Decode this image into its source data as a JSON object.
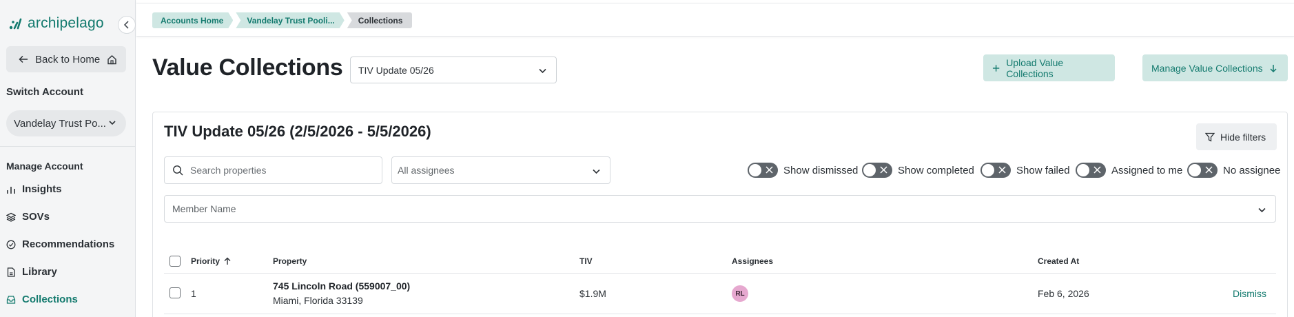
{
  "app": {
    "logo_text": "archipelago",
    "accent_color": "#137a6e"
  },
  "sidebar": {
    "back_label": "Back to Home",
    "switch_account_label": "Switch Account",
    "account_value": "Vandelay Trust Po...",
    "manage_account_label": "Manage Account",
    "items": [
      {
        "label": "Insights",
        "icon": "bar-chart-icon",
        "active": false
      },
      {
        "label": "SOVs",
        "icon": "layers-icon",
        "active": false
      },
      {
        "label": "Recommendations",
        "icon": "check-circle-icon",
        "active": false
      },
      {
        "label": "Library",
        "icon": "document-icon",
        "active": false
      },
      {
        "label": "Collections",
        "icon": "inbox-icon",
        "active": true
      }
    ]
  },
  "breadcrumbs": [
    "Accounts Home",
    "Vandelay Trust Pooli...",
    "Collections"
  ],
  "header": {
    "title": "Value Collections",
    "collection_value": "TIV Update 05/26",
    "upload_label": "Upload Value Collections",
    "manage_label": "Manage Value Collections"
  },
  "card": {
    "title": "TIV Update 05/26 (2/5/2026 - 5/5/2026)",
    "hide_filters_label": "Hide filters",
    "search_placeholder": "Search properties",
    "assignee_value": "All assignees",
    "member_value": "Member Name",
    "toggles": [
      "Show dismissed",
      "Show completed",
      "Show failed",
      "Assigned to me",
      "No assignee"
    ]
  },
  "table": {
    "columns": {
      "priority": "Priority",
      "property": "Property",
      "tiv": "TIV",
      "assignees": "Assignees",
      "created_at": "Created At"
    },
    "rows": [
      {
        "priority": "1",
        "property_name": "745 Lincoln Road (559007_00)",
        "property_address": "Miami, Florida 33139",
        "tiv": "$1.9M",
        "assignee_initials": "RL",
        "created_at": "Feb 6, 2026",
        "action": "Dismiss"
      }
    ]
  }
}
